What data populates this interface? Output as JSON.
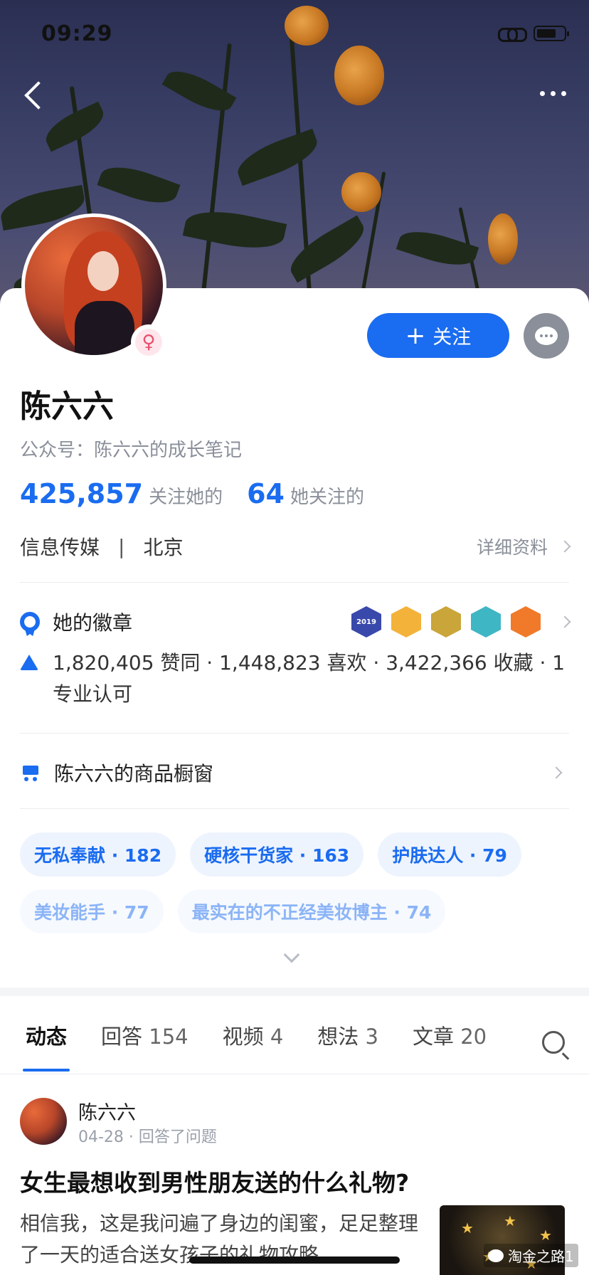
{
  "status_bar": {
    "time": "09:29"
  },
  "profile": {
    "name": "陈六六",
    "account": "公众号：陈六六的成长笔记",
    "follow_label": "关注",
    "followers_count": "425,857",
    "followers_label": "关注她的",
    "following_count": "64",
    "following_label": "她关注的",
    "industry": "信息传媒",
    "separator": "|",
    "location": "北京",
    "detail_link": "详细资料"
  },
  "badges": {
    "label": "她的徽章",
    "icons": [
      {
        "name": "year-2019-badge",
        "text": "2019",
        "color": "#3949ab"
      },
      {
        "name": "cow-badge-1",
        "text": "",
        "color": "#f3b23a"
      },
      {
        "name": "cow-badge-2",
        "text": "",
        "color": "#c9a53a"
      },
      {
        "name": "teal-badge",
        "text": "",
        "color": "#3fb6c4"
      },
      {
        "name": "orange-badge",
        "text": "",
        "color": "#f07a2a"
      }
    ]
  },
  "achievements": "1,820,405 赞同 · 1,448,823 喜欢 · 3,422,366 收藏 · 1 专业认可",
  "shop": {
    "label": "陈六六的商品橱窗"
  },
  "tags": [
    {
      "text": "无私奉献 · 182"
    },
    {
      "text": "硬核干货家 · 163"
    },
    {
      "text": "护肤达人 · 79"
    },
    {
      "text": "美妆能手 · 77"
    },
    {
      "text": "最实在的不正经美妆博主 · 74"
    }
  ],
  "tabs": [
    {
      "label": "动态",
      "count": ""
    },
    {
      "label": "回答",
      "count": "154"
    },
    {
      "label": "视频",
      "count": "4"
    },
    {
      "label": "想法",
      "count": "3"
    },
    {
      "label": "文章",
      "count": "20"
    }
  ],
  "feed": {
    "author": "陈六六",
    "meta": "04-28 · 回答了问题",
    "title": "女生最想收到男性朋友送的什么礼物?",
    "excerpt": "相信我，这是我问遍了身边的闺蜜，足足整理了一天的适合送女孩子的礼物攻略"
  },
  "watermark": "淘金之路1",
  "colors": {
    "accent": "#1a6cf0",
    "muted": "#8a8f99"
  }
}
